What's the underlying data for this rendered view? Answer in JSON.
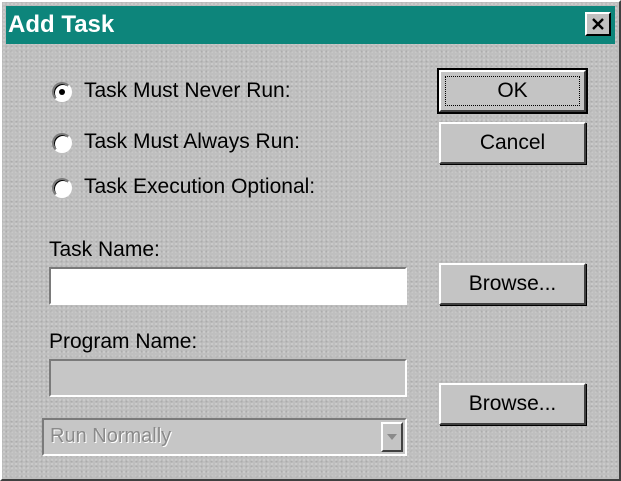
{
  "window": {
    "title": "Add Task",
    "close_glyph": "✕"
  },
  "options": [
    {
      "label": "Task Must Never Run:",
      "selected": true
    },
    {
      "label": "Task Must Always Run:",
      "selected": false
    },
    {
      "label": "Task Execution Optional:",
      "selected": false
    }
  ],
  "buttons": {
    "ok": "OK",
    "cancel": "Cancel",
    "browse_task": "Browse...",
    "browse_program": "Browse..."
  },
  "task_name": {
    "label": "Task Name:",
    "value": ""
  },
  "program_name": {
    "label": "Program Name:",
    "value": "",
    "disabled": true
  },
  "run_mode": {
    "selected": "Run Normally",
    "disabled": true
  },
  "colors": {
    "title_bar": "#0d857b",
    "dialog_bg": "#c0c0c0"
  },
  "icons": {
    "close": "close-icon",
    "dropdown": "chevron-down-icon"
  }
}
